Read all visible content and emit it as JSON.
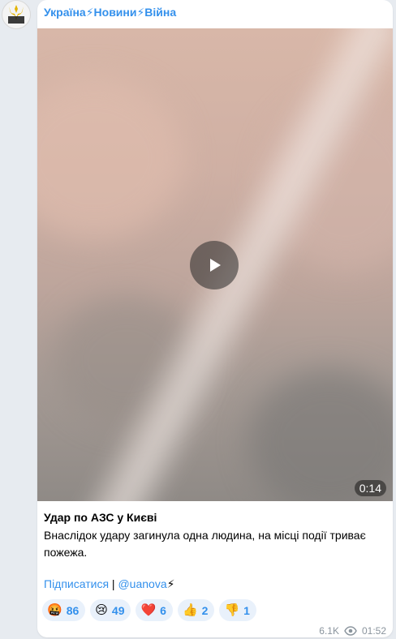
{
  "channel": {
    "name": "Україна⚡Новини⚡Війна"
  },
  "avatar": {
    "text": "УКРАЇНА НОВИНИ"
  },
  "video": {
    "duration": "0:14"
  },
  "post": {
    "title": "Удар по АЗС у Києві",
    "body": "Внаслідок удару загинула одна людина, на місці події триває пожежа.",
    "subscribe_link": "Підписатися",
    "separator": " | ",
    "handle_link": "@uanova",
    "handle_bolt": "⚡"
  },
  "reactions": [
    {
      "emoji": "🤬",
      "count": "86"
    },
    {
      "emoji": "😢",
      "count": "49"
    },
    {
      "emoji": "❤️",
      "count": "6"
    },
    {
      "emoji": "👍",
      "count": "2"
    },
    {
      "emoji": "👎",
      "count": "1"
    }
  ],
  "meta": {
    "views": "6.1K",
    "time": "01:52"
  },
  "colors": {
    "accent": "#3390ec",
    "background": "#e7ebf0"
  }
}
